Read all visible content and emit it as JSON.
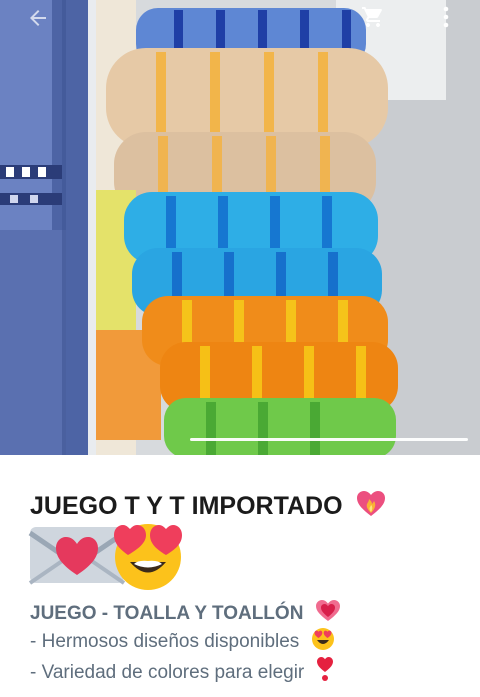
{
  "product": {
    "title": "JUEGO T Y T IMPORTADO",
    "subtitle": "JUEGO - TOALLA Y TOALLÓN",
    "bullets": [
      "- Hermosos diseños disponibles",
      "- Variedad de colores para elegir"
    ]
  },
  "gallery": {
    "photo_count_visible": 2
  },
  "icons": {
    "back": "arrow-left-icon",
    "cart": "shopping-cart-icon",
    "more": "more-vertical-icon",
    "heart_fire": "heart-on-fire-icon",
    "love_letter": "love-letter-icon",
    "heart_eyes": "smiling-face-with-heart-eyes-icon",
    "growing_heart": "growing-heart-icon",
    "exclamation_heart": "heart-exclamation-icon"
  },
  "colors": {
    "title": "#1b1b1b",
    "body_text": "#5f6e7d"
  }
}
